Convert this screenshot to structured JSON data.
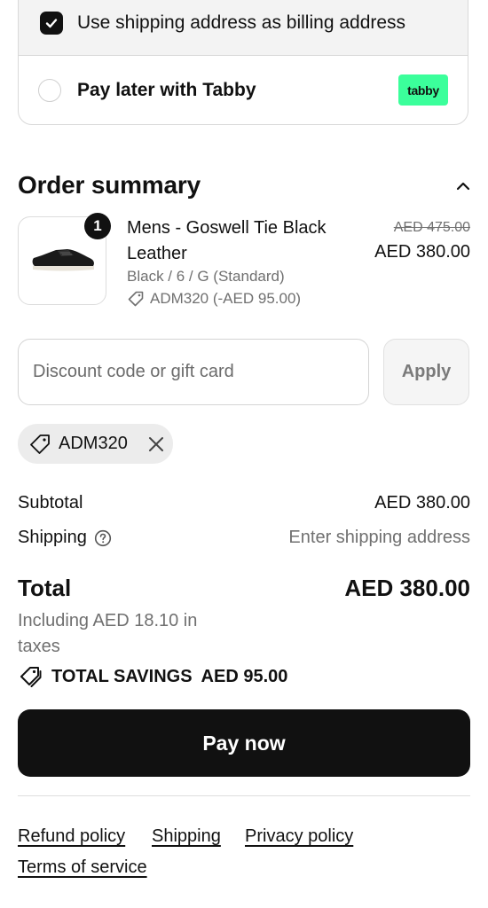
{
  "billing": {
    "use_shipping_label": "Use shipping address as billing address",
    "pay_later_label": "Pay later with Tabby",
    "tabby_badge": "tabby"
  },
  "summary": {
    "title": "Order summary",
    "item": {
      "quantity": "1",
      "name": "Mens - Goswell Tie Black Leather",
      "variant": "Black / 6 / G (Standard)",
      "discount": "ADM320 (-AED 95.00)",
      "original_price": "AED 475.00",
      "price": "AED 380.00"
    },
    "discount_placeholder": "Discount code or gift card",
    "apply_label": "Apply",
    "applied_code": "ADM320",
    "subtotal_label": "Subtotal",
    "subtotal_value": "AED 380.00",
    "shipping_label": "Shipping",
    "shipping_value": "Enter shipping address",
    "total_label": "Total",
    "total_value": "AED 380.00",
    "tax_note": "Including AED 18.10 in taxes",
    "savings_label": "TOTAL SAVINGS",
    "savings_value": "AED 95.00",
    "pay_label": "Pay now"
  },
  "footer": {
    "links": [
      "Refund policy",
      "Shipping",
      "Privacy policy",
      "Terms of service"
    ]
  },
  "colors": {
    "primary": "#111111",
    "muted_text": "#707070",
    "tabby_green": "#3bff9b",
    "chip_bg": "#ececec"
  }
}
